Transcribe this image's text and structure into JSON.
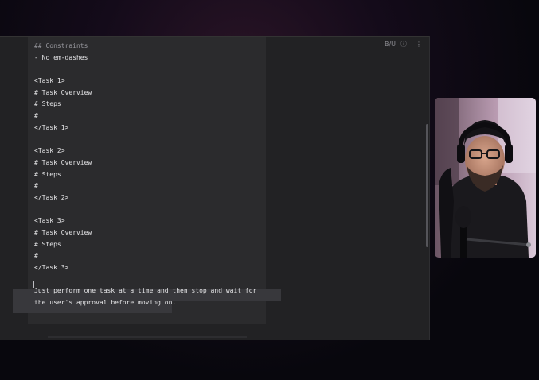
{
  "toolbar": {
    "format_label": "B/U",
    "info_icon": "info-icon",
    "more_icon": "more-vertical-icon"
  },
  "editor": {
    "lines": [
      "## Constraints",
      "- No em-dashes",
      "",
      "<Task 1>",
      "# Task Overview",
      "# Steps",
      "#",
      "</Task 1>",
      "",
      "<Task 2>",
      "# Task Overview",
      "# Steps",
      "#",
      "</Task 2>",
      "",
      "<Task 3>",
      "# Task Overview",
      "# Steps",
      "#",
      "</Task 3>",
      "",
      "Just perform one task at a time and then stop and wait for",
      "the user's approval before moving on."
    ]
  },
  "webcam": {
    "subject": "presenter-webcam"
  },
  "colors": {
    "editor_bg": "#222224",
    "doc_bg": "#2b2b2d",
    "text": "#e4e4e6",
    "selection": "#38383c"
  }
}
